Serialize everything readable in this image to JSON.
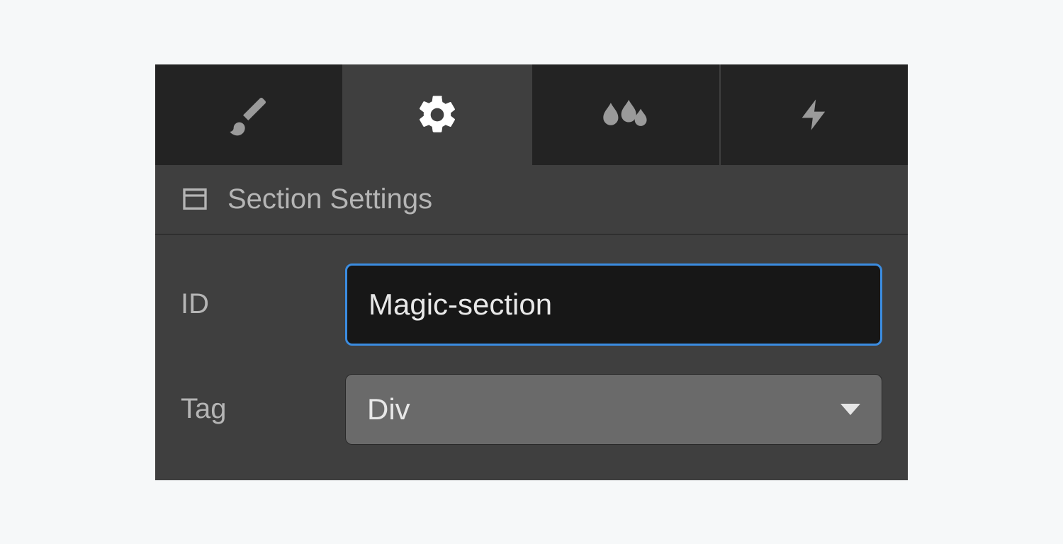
{
  "tabs": {
    "style_icon": "brush-icon",
    "settings_icon": "gear-icon",
    "effects_icon": "droplets-icon",
    "interactions_icon": "bolt-icon"
  },
  "section": {
    "title": "Section Settings",
    "header_icon": "section-icon"
  },
  "fields": {
    "id": {
      "label": "ID",
      "value": "Magic-section"
    },
    "tag": {
      "label": "Tag",
      "selected": "Div"
    }
  }
}
